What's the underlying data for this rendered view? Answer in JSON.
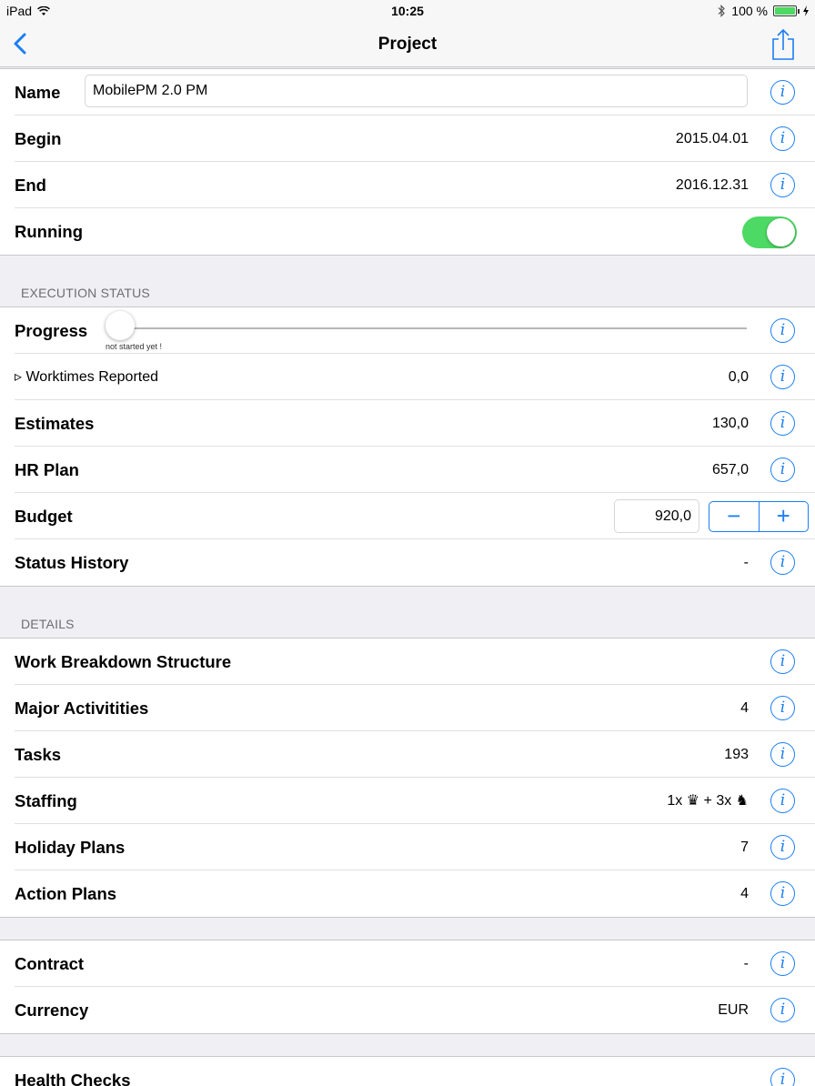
{
  "status_bar": {
    "device": "iPad",
    "time": "10:25",
    "battery": "100 %",
    "battery_level": 1.0
  },
  "nav": {
    "title": "Project"
  },
  "general": {
    "name_label": "Name",
    "name_value": "MobilePM 2.0 PM",
    "begin_label": "Begin",
    "begin_value": "2015.04.01",
    "end_label": "End",
    "end_value": "2016.12.31",
    "running_label": "Running",
    "running_on": true
  },
  "execution": {
    "header": "EXECUTION STATUS",
    "progress_label": "Progress",
    "progress_value": 0,
    "progress_caption": "not started yet !",
    "worktimes_label": "▹ Worktimes Reported",
    "worktimes_value": "0,0",
    "estimates_label": "Estimates",
    "estimates_value": "130,0",
    "hrplan_label": "HR Plan",
    "hrplan_value": "657,0",
    "budget_label": "Budget",
    "budget_value": "920,0",
    "stepper_minus": "−",
    "stepper_plus": "+",
    "history_label": "Status History",
    "history_value": "-"
  },
  "details": {
    "header": "DETAILS",
    "wbs_label": "Work Breakdown Structure",
    "activities_label": "Major Activitities",
    "activities_value": "4",
    "tasks_label": "Tasks",
    "tasks_value": "193",
    "staffing_label": "Staffing",
    "staffing_value": "1x ♛ + 3x ♞",
    "holiday_label": "Holiday Plans",
    "holiday_value": "7",
    "action_label": "Action Plans",
    "action_value": "4"
  },
  "contract": {
    "contract_label": "Contract",
    "contract_value": "-",
    "currency_label": "Currency",
    "currency_value": "EUR"
  },
  "health": {
    "label": "Health Checks"
  },
  "icons": {
    "info": "info-icon",
    "back": "chevron-left-icon",
    "share": "share-icon",
    "wifi": "wifi-icon",
    "bluetooth": "bluetooth-icon",
    "accent": "#1a7ef5",
    "toggle_on": "#4cd964"
  },
  "info_glyph": "i"
}
